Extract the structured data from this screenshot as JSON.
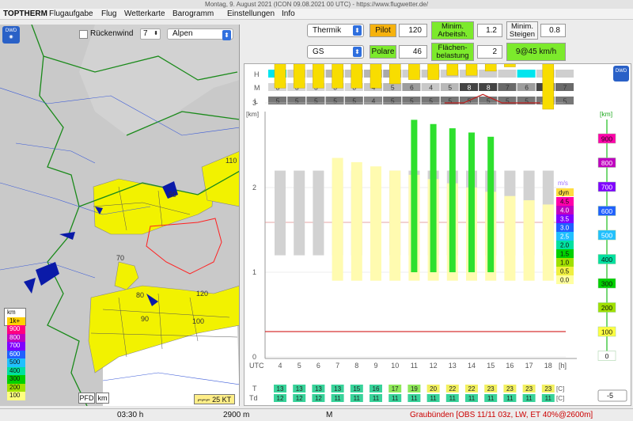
{
  "window": {
    "title": "Montag, 9. August 2021 (ICON 09.08.2021 00 UTC) - https://www.flugwetter.de/"
  },
  "menu": [
    "TOPTHERM",
    "Flugaufgabe",
    "Flug",
    "Wetterkarte",
    "Barogramm",
    "Einstellungen",
    "Info"
  ],
  "map": {
    "logo": "DWD",
    "rueckenwind_label": "Rückenwind",
    "rueckenwind_checked": false,
    "stepper_value": "7",
    "region": "Alpen",
    "contour_labels": [
      "110",
      "50",
      "70",
      "80",
      "120",
      "90",
      "100"
    ],
    "legend": {
      "unit": "km",
      "items": [
        {
          "label": "1k+",
          "color": "#ffd000"
        },
        {
          "label": "900",
          "color": "#ff0080"
        },
        {
          "label": "800",
          "color": "#c000c0"
        },
        {
          "label": "700",
          "color": "#8000ff"
        },
        {
          "label": "600",
          "color": "#2060ff"
        },
        {
          "label": "500",
          "color": "#20c0ff"
        },
        {
          "label": "400",
          "color": "#00e0a0"
        },
        {
          "label": "300",
          "color": "#00d000"
        },
        {
          "label": "200",
          "color": "#a0e000"
        },
        {
          "label": "100",
          "color": "#ffff80"
        }
      ]
    },
    "pfd_label": "PFD",
    "km_label": "km",
    "wind_legend": "25 KT"
  },
  "controls": {
    "mode_select": "Thermik",
    "pilot_label": "Pilot",
    "pilot_value": "120",
    "min_arbeit_label1": "Minim.",
    "min_arbeit_label2": "Arbeitsh.",
    "min_arbeit_value": "1.2",
    "min_steigen_label1": "Minim.",
    "min_steigen_label2": "Steigen",
    "min_steigen_value": "0.8",
    "glider_select": "GS",
    "polare_label": "Polare",
    "polare_value": "46",
    "flaechen_label1": "Flächen-",
    "flaechen_label2": "belastung",
    "flaechen_value": "2",
    "speed_value": "9@45 km/h"
  },
  "chart": {
    "logo": "DWD",
    "cloud_rows": [
      {
        "name": "H",
        "values": [
          "",
          "",
          "",
          "6",
          "5",
          "6",
          "7",
          "",
          "4",
          "",
          "",
          "",
          "",
          "",
          "",
          ""
        ],
        "shades": [
          "#00e5ee",
          "#cfcfcf",
          "#cfcfcf",
          "#b5b5b5",
          "#c3c3c3",
          "#b5b5b5",
          "#a9a9a9",
          "#cfcfcf",
          "#c9c9c9",
          "#cfcfcf",
          "#cfcfcf",
          "#cfcfcf",
          "#cfcfcf",
          "#00e5ee",
          "#cfcfcf",
          "#cfcfcf"
        ]
      },
      {
        "name": "M",
        "values": [
          "3",
          "3",
          "3",
          "3",
          "3",
          "4",
          "5",
          "6",
          "4",
          "5",
          "8",
          "8",
          "7",
          "6",
          "8",
          "7"
        ],
        "shades": [
          "#d6d6d6",
          "#d6d6d6",
          "#d6d6d6",
          "#d6d6d6",
          "#d6d6d6",
          "#c8c8c8",
          "#b8b8b8",
          "#9d9d9d",
          "#c8c8c8",
          "#b8b8b8",
          "#444444",
          "#444444",
          "#6a6a6a",
          "#9d9d9d",
          "#444444",
          "#6a6a6a"
        ]
      },
      {
        "name": "L",
        "values": [
          "5",
          "5",
          "5",
          "5",
          "5",
          "4",
          "5",
          "5",
          "5",
          "5",
          "5",
          "5",
          "5",
          "5",
          "5",
          "5"
        ],
        "shades": [
          "#777777",
          "#777777",
          "#777777",
          "#777777",
          "#777777",
          "#888888",
          "#777777",
          "#777777",
          "#777777",
          "#777777",
          "#777777",
          "#777777",
          "#777777",
          "#777777",
          "#777777",
          "#777777"
        ]
      }
    ],
    "y_unit": "[km]",
    "y_ticks": [
      "4",
      "3",
      "2",
      "1",
      "0"
    ],
    "x_label": "UTC",
    "x_ticks": [
      "4",
      "5",
      "6",
      "7",
      "8",
      "9",
      "10",
      "11",
      "12",
      "13",
      "14",
      "15",
      "16",
      "17",
      "18",
      "[h]"
    ],
    "right_scale_unit": "[km]",
    "right_scale": [
      {
        "label": "900",
        "color": "#ff00aa"
      },
      {
        "label": "800",
        "color": "#c000c0"
      },
      {
        "label": "700",
        "color": "#8000ff"
      },
      {
        "label": "600",
        "color": "#2060ff"
      },
      {
        "label": "500",
        "color": "#20c0ff"
      },
      {
        "label": "400",
        "color": "#00e0a0"
      },
      {
        "label": "300",
        "color": "#00d000"
      },
      {
        "label": "200",
        "color": "#a0e000"
      },
      {
        "label": "100",
        "color": "#ffff40"
      },
      {
        "label": "0",
        "color": "#ffffff"
      }
    ],
    "climb_legend_unit": "m/s",
    "climb_legend_title": "dyn",
    "climb_legend": [
      {
        "label": "4.5",
        "color": "#ff00aa"
      },
      {
        "label": "4.0",
        "color": "#c000c0"
      },
      {
        "label": "3.5",
        "color": "#8000ff"
      },
      {
        "label": "3.0",
        "color": "#2060ff"
      },
      {
        "label": "2.5",
        "color": "#20c0ff"
      },
      {
        "label": "2.0",
        "color": "#00e0a0"
      },
      {
        "label": "1.5",
        "color": "#00d000"
      },
      {
        "label": "1.0",
        "color": "#a0e000"
      },
      {
        "label": "0.5",
        "color": "#f0f040"
      },
      {
        "label": "0.0",
        "color": "#ffffa0"
      }
    ],
    "T_label": "T",
    "Td_label": "Td",
    "T": [
      "13",
      "13",
      "13",
      "13",
      "15",
      "16",
      "17",
      "19",
      "20",
      "22",
      "22",
      "23",
      "23",
      "23",
      "23",
      "23"
    ],
    "Td": [
      "12",
      "12",
      "12",
      "11",
      "11",
      "11",
      "11",
      "11",
      "11",
      "11",
      "11",
      "11",
      "11",
      "11",
      "11",
      "11"
    ],
    "temp_unit": "[C]",
    "offset_value": "-5"
  },
  "status": {
    "time": "03:30 h",
    "height": "2900 m",
    "mode": "M",
    "message": "Graubünden [OBS 11/11 03z, LW, ET  40%@2600m]"
  },
  "colors": {
    "thermal_yellow": "#f8dd00",
    "climb_green": "#2ee02e",
    "light_yellow": "#fffbb0",
    "cloud_grey": "#c8c8c8",
    "message_red": "#cc0000"
  }
}
